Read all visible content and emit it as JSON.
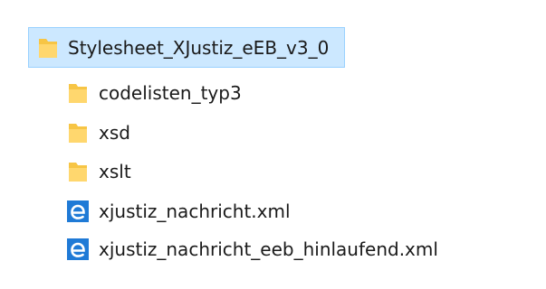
{
  "root_folder": {
    "name": "Stylesheet_XJustiz_eEB_v3_0",
    "icon": "folder-icon"
  },
  "items": [
    {
      "name": "codelisten_typ3",
      "icon": "folder-icon",
      "type": "folder"
    },
    {
      "name": "xsd",
      "icon": "folder-icon",
      "type": "folder"
    },
    {
      "name": "xslt",
      "icon": "folder-icon",
      "type": "folder"
    },
    {
      "name": "xjustiz_nachricht.xml",
      "icon": "edge-xml-icon",
      "type": "file"
    },
    {
      "name": "xjustiz_nachricht_eeb_hinlaufend.xml",
      "icon": "edge-xml-icon",
      "type": "file"
    }
  ],
  "colors": {
    "selection_background": "#cce8ff",
    "selection_border": "#99d1ff",
    "folder": "#ffd76e",
    "edge_blue": "#1f7ad6"
  }
}
